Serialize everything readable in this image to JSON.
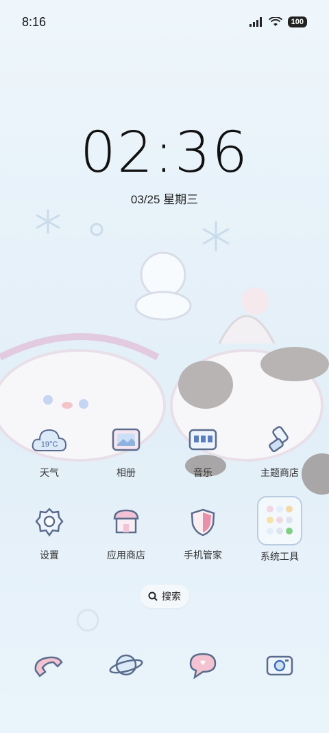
{
  "status": {
    "time": "8:16",
    "battery": "100"
  },
  "lockscreen": {
    "clock": "02:36",
    "date": "03/25 星期三"
  },
  "apps_row1": [
    {
      "label": "天气",
      "icon": "weather-icon",
      "badge": "19°C"
    },
    {
      "label": "相册",
      "icon": "gallery-icon"
    },
    {
      "label": "音乐",
      "icon": "music-icon"
    },
    {
      "label": "主题商店",
      "icon": "theme-store-icon"
    }
  ],
  "apps_row2": [
    {
      "label": "设置",
      "icon": "settings-icon"
    },
    {
      "label": "应用商店",
      "icon": "app-store-icon"
    },
    {
      "label": "手机管家",
      "icon": "phone-manager-icon"
    },
    {
      "label": "系统工具",
      "icon": "system-tools-folder-icon"
    }
  ],
  "search": {
    "label": "搜索"
  },
  "dock": [
    "phone-icon",
    "browser-icon",
    "messages-icon",
    "camera-icon"
  ]
}
